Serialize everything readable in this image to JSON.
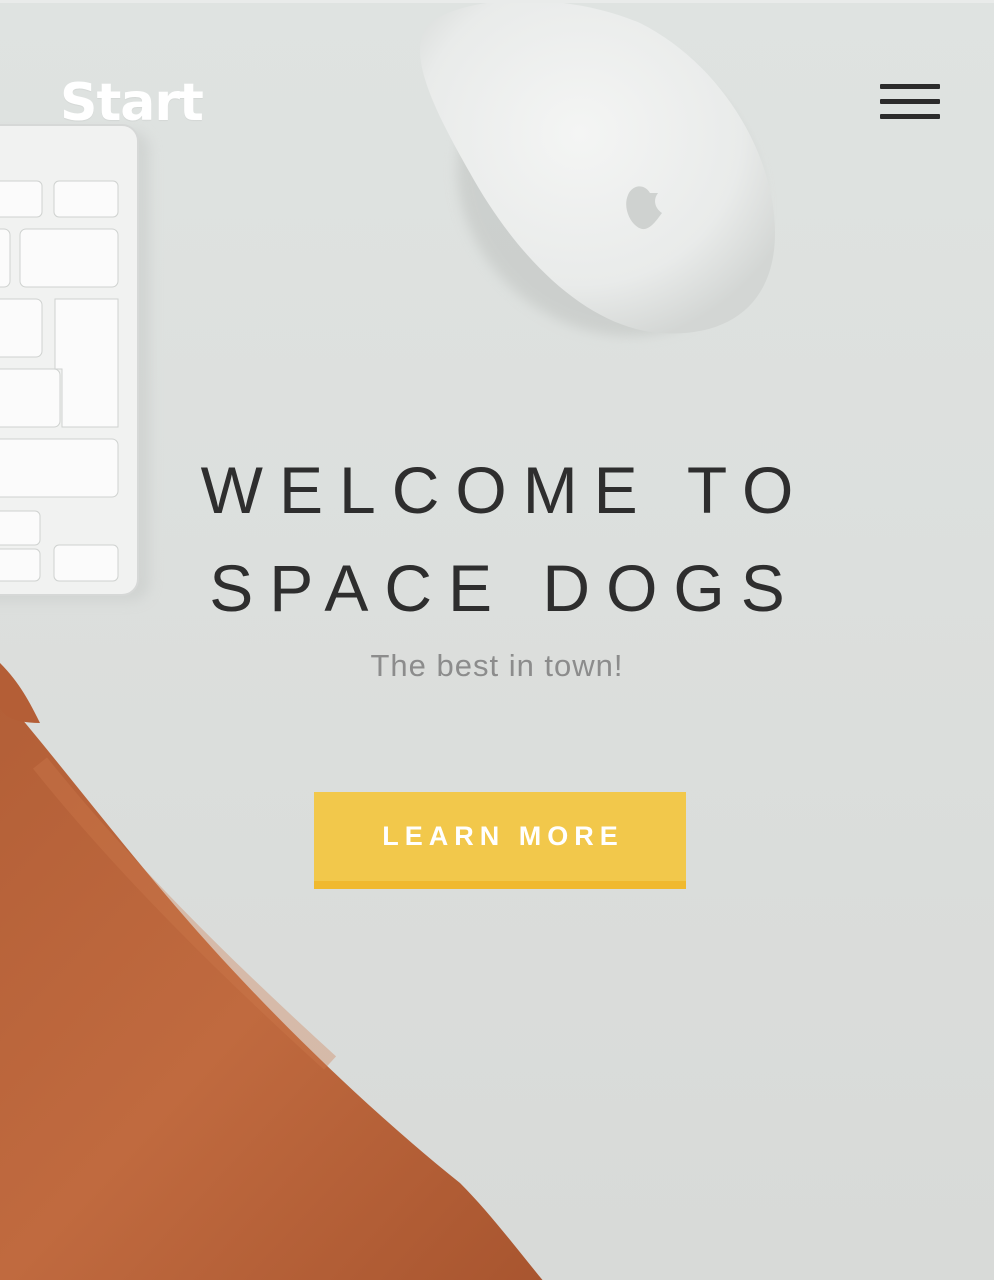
{
  "header": {
    "brand": "Start",
    "menu_icon": "hamburger-menu-icon"
  },
  "hero": {
    "headline_line1": "WELCOME TO",
    "headline_line2": "SPACE DOGS",
    "tagline": "The best in town!",
    "cta_label": "LEARN MORE"
  },
  "colors": {
    "accent": "#f2c84b",
    "accent_border": "#f0b92e",
    "headline": "#2e2e2e",
    "tagline": "#8c8c8c",
    "background": "#dcdfdd"
  }
}
